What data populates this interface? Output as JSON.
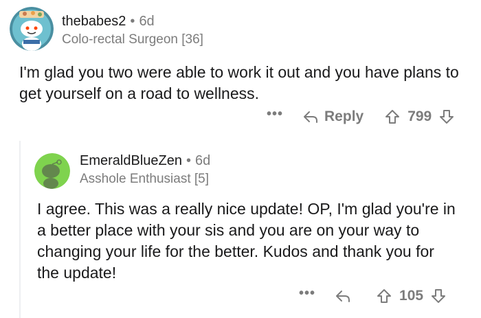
{
  "comments": [
    {
      "username": "thebabes2",
      "age": "6d",
      "flair": "Colo-rectal Surgeon [36]",
      "body": "I'm glad you two were able to work it out and you have plans to get yourself on a road to wellness.",
      "more": "•••",
      "reply_label": "Reply",
      "votes": "799"
    },
    {
      "username": "EmeraldBlueZen",
      "age": "6d",
      "flair": "Asshole Enthusiast [5]",
      "body": "I agree. This was a really nice update! OP, I'm glad you're in a better place with your sis and you are on your way to changing your life for the better. Kudos and thank you for the update!",
      "more": "•••",
      "votes": "105"
    }
  ],
  "colors": {
    "accent_green": "#7fd34e",
    "meta_grey": "#7c7c7c",
    "text": "#1a1a1b"
  },
  "icons": [
    "snoo-avatar-icon",
    "reply-arrow-icon",
    "upvote-icon",
    "downvote-icon"
  ]
}
